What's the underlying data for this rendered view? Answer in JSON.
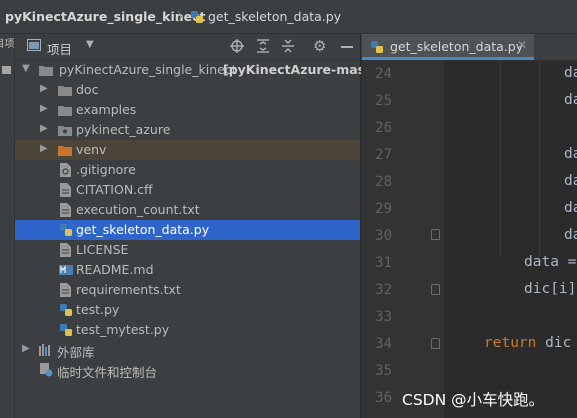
{
  "breadcrumb": {
    "project": "pyKinectAzure_single_kinect",
    "file": "get_skeleton_data.py"
  },
  "stripe": {
    "label": "项目"
  },
  "panel": {
    "title": "项目",
    "icons": [
      "globe-icon",
      "expand-all-icon",
      "collapse-all-icon",
      "gear-icon",
      "minimize-icon"
    ]
  },
  "tree": {
    "root": "pyKinectAzure_single_kinect",
    "root_suffix": "[pyKinectAzure-master",
    "items": [
      {
        "label": "doc",
        "type": "folder"
      },
      {
        "label": "examples",
        "type": "folder"
      },
      {
        "label": "pykinect_azure",
        "type": "package"
      },
      {
        "label": "venv",
        "type": "venv-folder"
      },
      {
        "label": ".gitignore",
        "type": "file"
      },
      {
        "label": "CITATION.cff",
        "type": "file"
      },
      {
        "label": "execution_count.txt",
        "type": "file"
      },
      {
        "label": "get_skeleton_data.py",
        "type": "python"
      },
      {
        "label": "LICENSE",
        "type": "file"
      },
      {
        "label": "README.md",
        "type": "markdown"
      },
      {
        "label": "requirements.txt",
        "type": "file"
      },
      {
        "label": "test.py",
        "type": "python"
      },
      {
        "label": "test_mytest.py",
        "type": "python"
      }
    ],
    "external_libs": "外部库",
    "scratches": "临时文件和控制台"
  },
  "editor": {
    "tab_label": "get_skeleton_data.py",
    "line_numbers": [
      "24",
      "25",
      "26",
      "27",
      "28",
      "29",
      "30",
      "31",
      "32",
      "33",
      "34",
      "35",
      "36"
    ],
    "lines": [
      "da",
      "da",
      "",
      "da",
      "da",
      "da",
      "da",
      "data =",
      "dic[i]",
      "",
      "return dic",
      "",
      ""
    ]
  },
  "watermark": "CSDN @小车快跑。"
}
